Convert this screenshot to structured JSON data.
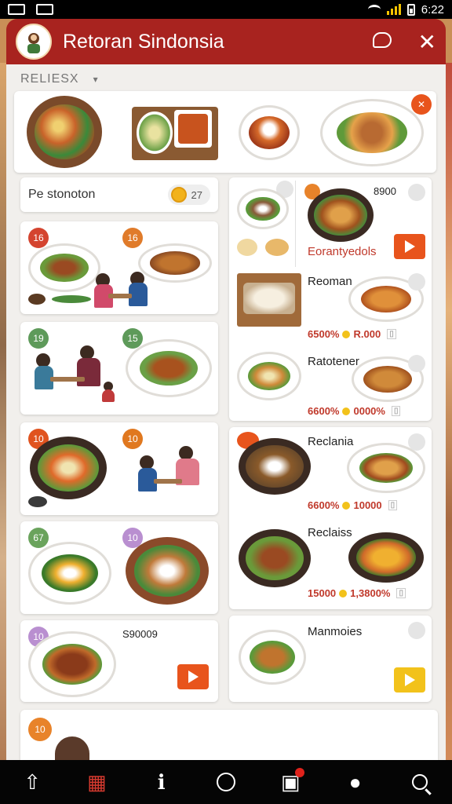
{
  "status_bar": {
    "time": "6:22"
  },
  "header": {
    "title": "Retoran Sindonsia"
  },
  "section": {
    "label": "RELIESX"
  },
  "search": {
    "text": "Pe stonoton",
    "chip_value": "27"
  },
  "left_cards": [
    {
      "badge1": "16",
      "badge2": "16",
      "badge_color": "#d4442f",
      "badge2_color": "#e07b2a"
    },
    {
      "badge1": "19",
      "badge2": "15",
      "badge_color": "#5e9a5a",
      "badge2_color": "#5e9a5a"
    },
    {
      "badge1": "10",
      "badge2": "10",
      "badge_color": "#e0531f",
      "badge2_color": "#e0781f"
    },
    {
      "badge1": "67",
      "badge2": "10",
      "badge_color": "#6aa35c",
      "badge2_color": "#b98fd0"
    },
    {
      "badge1": "10",
      "title": "S90009",
      "badge_color": "#b98fd0"
    },
    {
      "badge1": "10",
      "badge_color": "#e8832a"
    }
  ],
  "right_cards": {
    "top": {
      "price": "8900",
      "red_label": "Eorantyedols"
    },
    "items": [
      {
        "title": "Reoman",
        "price1": "6500%",
        "price2": "R.000"
      },
      {
        "title": "Ratotener",
        "price1": "6600%",
        "price2": "0000%"
      },
      {
        "title": "Reclania",
        "price1": "6600%",
        "price2": "10000"
      },
      {
        "title": "Reclaiss",
        "price1": "15000",
        "price2": "1,3800%"
      },
      {
        "title": "Manmoies"
      }
    ]
  },
  "colors": {
    "primary": "#a8231f",
    "accent": "#e8541c",
    "yellow": "#f2c21b"
  }
}
